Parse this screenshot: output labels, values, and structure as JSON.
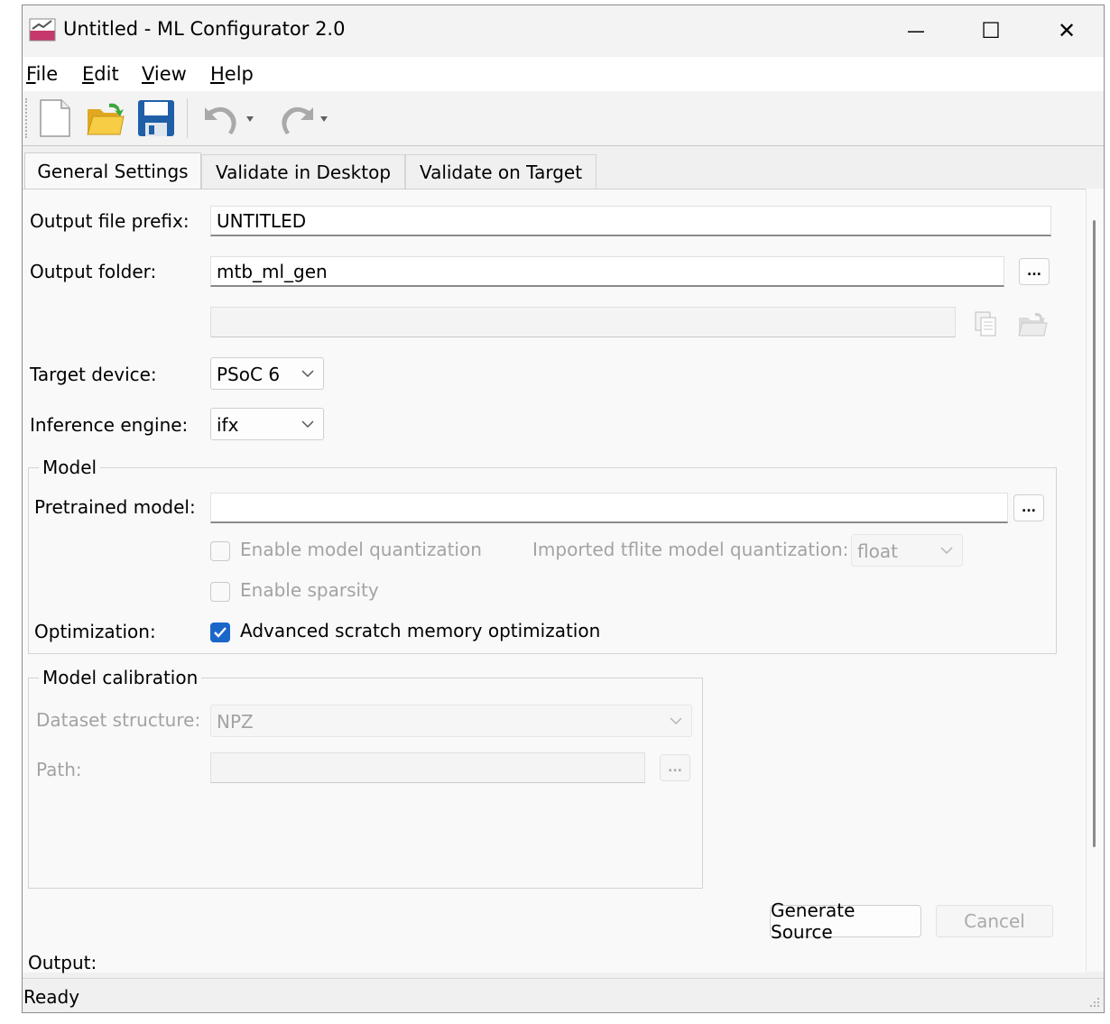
{
  "window": {
    "title": "Untitled - ML Configurator 2.0"
  },
  "window_controls": {
    "minimize": "—",
    "maximize": "☐",
    "close": "✕"
  },
  "menu": [
    {
      "label": "File",
      "accel": "F",
      "rest": "ile"
    },
    {
      "label": "Edit",
      "accel": "E",
      "rest": "dit"
    },
    {
      "label": "View",
      "accel": "V",
      "rest": "iew"
    },
    {
      "label": "Help",
      "accel": "H",
      "rest": "elp"
    }
  ],
  "toolbar": {
    "icons": [
      "new-document-icon",
      "open-folder-icon",
      "save-icon",
      "undo-icon",
      "redo-icon"
    ]
  },
  "tabs": [
    "General Settings",
    "Validate in Desktop",
    "Validate on Target"
  ],
  "active_tab": "General Settings",
  "general": {
    "output_prefix_label": "Output file prefix:",
    "output_prefix_value": "UNTITLED",
    "output_folder_label": "Output folder:",
    "output_folder_value": "mtb_ml_gen",
    "browse_label": "...",
    "full_path_value": "",
    "target_device_label": "Target device:",
    "target_device_value": "PSoC 6",
    "inference_engine_label": "Inference engine:",
    "inference_engine_value": "ifx"
  },
  "model": {
    "group_title": "Model",
    "pretrained_label": "Pretrained model:",
    "pretrained_value": "",
    "browse_label": "...",
    "quantization_label": "Enable model quantization",
    "quantization_checked": false,
    "imported_quant_label": "Imported tflite model quantization:",
    "imported_quant_value": "float",
    "sparsity_label": "Enable sparsity",
    "sparsity_checked": false,
    "optimization_label": "Optimization:",
    "scratch_label": "Advanced scratch memory optimization",
    "scratch_checked": true
  },
  "calibration": {
    "group_title": "Model calibration",
    "dataset_label": "Dataset structure:",
    "dataset_value": "NPZ",
    "path_label": "Path:",
    "path_value": "",
    "browse_label": "..."
  },
  "actions": {
    "generate": "Generate Source",
    "cancel": "Cancel"
  },
  "output_label": "Output:",
  "status": "Ready",
  "colors": {
    "accent": "#1b66c9",
    "panel": "#f9f9f9",
    "chrome": "#f0f0f0"
  }
}
